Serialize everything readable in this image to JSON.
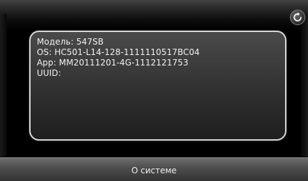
{
  "header": {
    "back_icon": "refresh-back-icon"
  },
  "info": {
    "model": "Модель: 547SB",
    "os": "OS: HC501-L14-128-1111110517BC04",
    "app": "App: MM20111201-4G-1112121753",
    "uuid": "UUID:"
  },
  "footer": {
    "title": "О системе"
  },
  "colors": {
    "panel_border": "#d9d9d9",
    "text": "#f2f2f2",
    "background": "#000000"
  }
}
